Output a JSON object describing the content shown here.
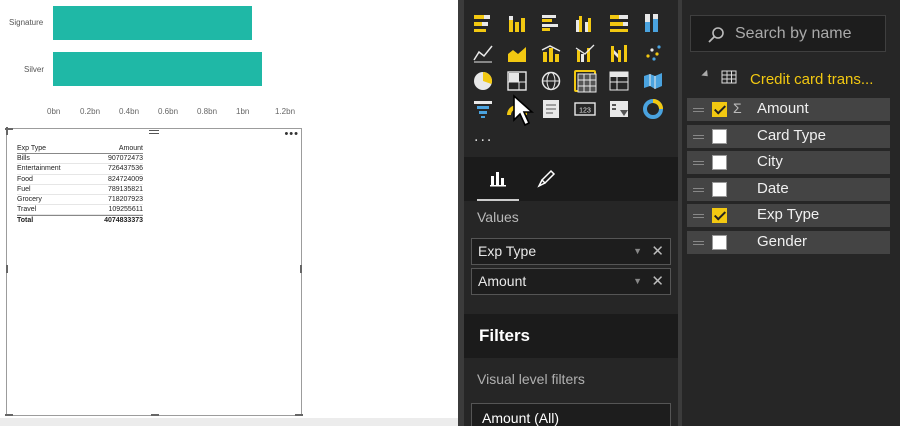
{
  "canvas": {
    "bar_chart": {
      "categories": [
        "Signature",
        "Silver"
      ],
      "x_ticks": [
        "0bn",
        "0.2bn",
        "0.4bn",
        "0.6bn",
        "0.8bn",
        "1bn",
        "1.2bn"
      ]
    },
    "table": {
      "headers": [
        "Exp Type",
        "Amount"
      ],
      "rows": [
        {
          "type": "Bills",
          "amount": "907072473"
        },
        {
          "type": "Entertainment",
          "amount": "726437536"
        },
        {
          "type": "Food",
          "amount": "824724009"
        },
        {
          "type": "Fuel",
          "amount": "789135821"
        },
        {
          "type": "Grocery",
          "amount": "718207923"
        },
        {
          "type": "Travel",
          "amount": "109255611"
        }
      ],
      "total_label": "Total",
      "total_value": "4074833373"
    }
  },
  "chart_data": {
    "type": "bar",
    "orientation": "horizontal",
    "categories": [
      "Signature",
      "Silver"
    ],
    "values": [
      1.02,
      1.07
    ],
    "unit": "bn",
    "xlim": [
      0,
      1.2
    ],
    "bar_color": "#1fb8a6"
  },
  "viz_pane": {
    "icons": [
      "stacked-bar-chart-icon",
      "stacked-column-chart-icon",
      "clustered-bar-chart-icon",
      "clustered-column-chart-icon",
      "100-stacked-bar-chart-icon",
      "100-stacked-column-chart-icon",
      "line-chart-icon",
      "area-chart-icon",
      "line-stacked-column-chart-icon",
      "line-clustered-column-chart-icon",
      "ribbon-chart-icon",
      "scatter-chart-icon",
      "pie-chart-icon",
      "treemap-icon",
      "map-icon",
      "table-icon",
      "matrix-icon",
      "filled-map-icon",
      "funnel-icon",
      "gauge-icon",
      "multi-row-card-icon",
      "card-icon",
      "slicer-icon",
      "donut-chart-icon"
    ],
    "more_label": "...",
    "values_label": "Values",
    "wells": [
      "Exp Type",
      "Amount"
    ],
    "filters_title": "Filters",
    "visual_level_filters_label": "Visual level filters",
    "filter_card": "Amount (All)"
  },
  "fields_pane": {
    "search_placeholder": "Search by name",
    "table_name": "Credit card trans...",
    "fields": [
      {
        "name": "Amount",
        "checked": true,
        "sigma": "Σ"
      },
      {
        "name": "Card Type",
        "checked": false
      },
      {
        "name": "City",
        "checked": false
      },
      {
        "name": "Date",
        "checked": false
      },
      {
        "name": "Exp Type",
        "checked": true
      },
      {
        "name": "Gender",
        "checked": false
      }
    ]
  },
  "colors": {
    "accent": "#f2c811",
    "bar": "#1fb8a6",
    "pane_bg": "#262626"
  }
}
